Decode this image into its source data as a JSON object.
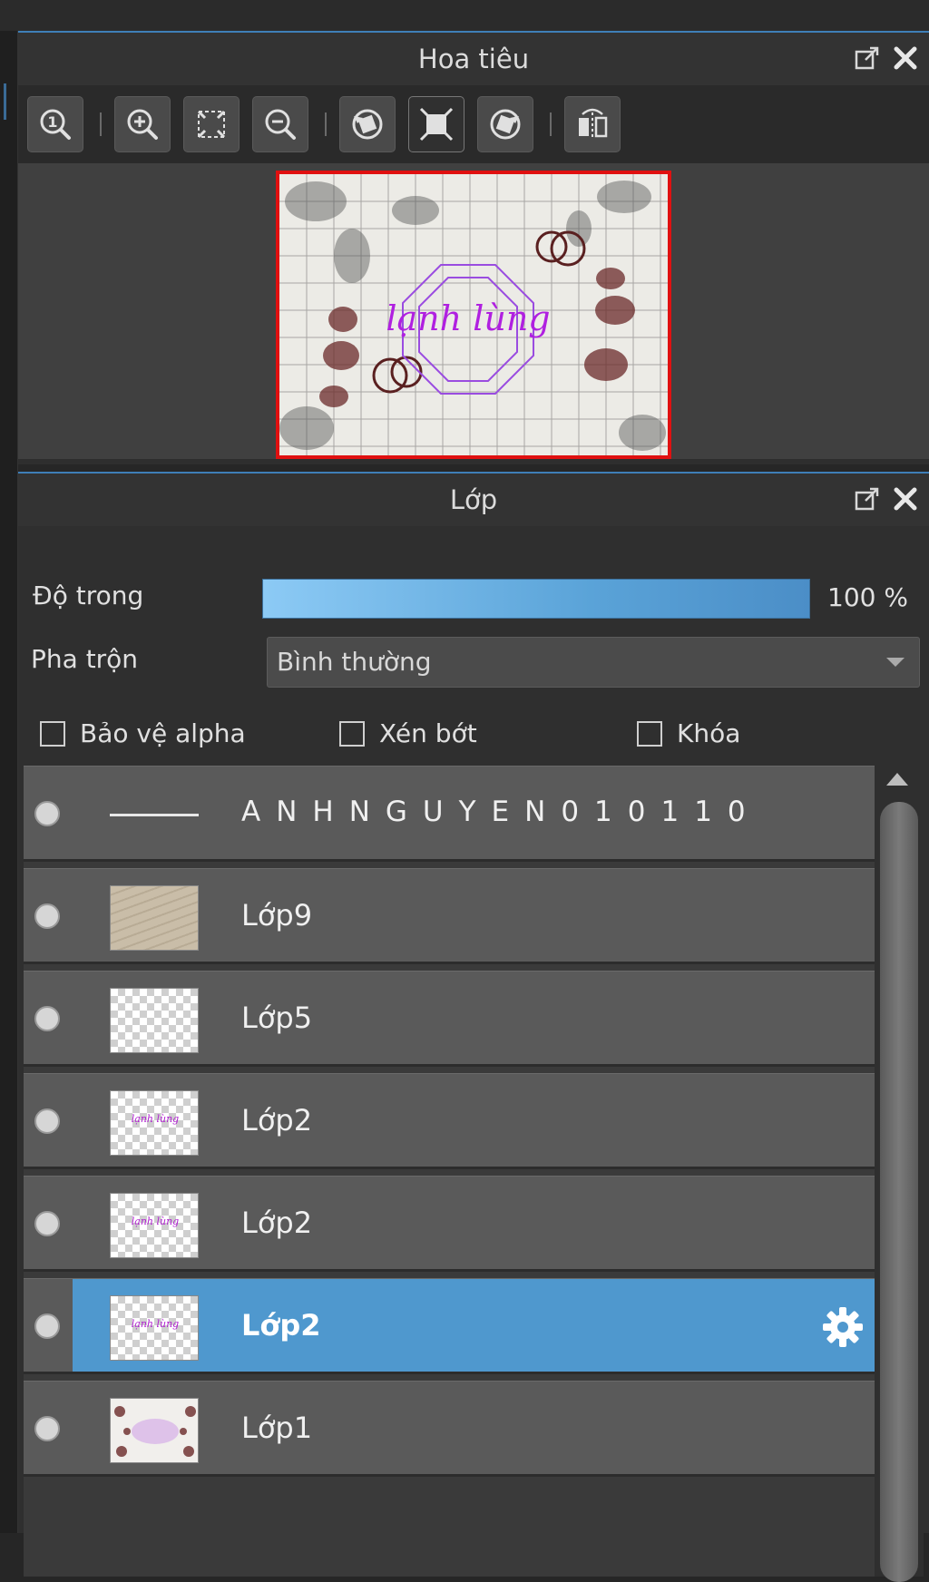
{
  "navigator": {
    "title": "Hoa tiêu",
    "toolbar": [
      {
        "icon": "zoom-actual-size-icon"
      },
      {
        "icon": "zoom-in-icon"
      },
      {
        "icon": "fit-to-window-icon"
      },
      {
        "icon": "zoom-out-icon"
      },
      {
        "icon": "rotate-left-icon"
      },
      {
        "icon": "reset-view-icon",
        "active": true
      },
      {
        "icon": "rotate-right-icon"
      },
      {
        "icon": "flip-horizontal-icon"
      }
    ],
    "preview_text": "lạnh lùng"
  },
  "layers_panel": {
    "title": "Lớp",
    "opacity_label": "Độ trong",
    "opacity_value": "100 %",
    "opacity_fraction": 1.0,
    "blend_label": "Pha trộn",
    "blend_value": "Bình thường",
    "checkboxes": {
      "protect_alpha": "Bảo vệ alpha",
      "clip": "Xén bớt",
      "lock": "Khóa"
    },
    "layers": [
      {
        "name": "ANHNGUYEN010110",
        "thumb": "line",
        "visible": true
      },
      {
        "name": "Lớp9",
        "thumb": "paper",
        "visible": true
      },
      {
        "name": "Lớp5",
        "thumb": "checker",
        "visible": true
      },
      {
        "name": "Lớp2",
        "thumb": "checker-text",
        "visible": true
      },
      {
        "name": "Lớp2",
        "thumb": "checker-text",
        "visible": true
      },
      {
        "name": "Lớp2",
        "thumb": "checker-text",
        "visible": true,
        "selected": true
      },
      {
        "name": "Lớp1",
        "thumb": "artwork",
        "visible": true
      }
    ],
    "thumb_mini_text": "lạnh lùng"
  },
  "colors": {
    "accent": "#4f98ce",
    "preview_border": "#e01010"
  }
}
